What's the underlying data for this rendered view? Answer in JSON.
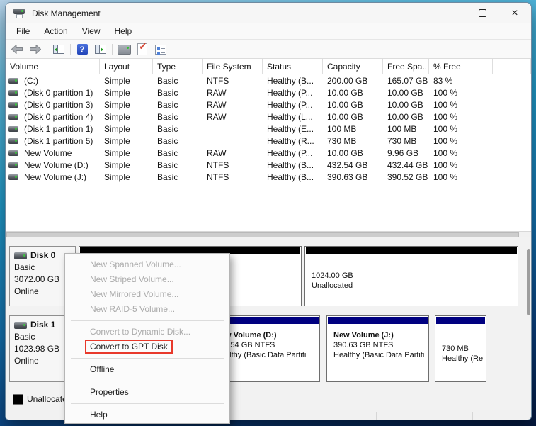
{
  "window": {
    "title": "Disk Management"
  },
  "menu_bar": [
    "File",
    "Action",
    "View",
    "Help"
  ],
  "icons": {
    "help_glyph": "?",
    "close_glyph": "×",
    "check_glyph": "✓"
  },
  "volume_table": {
    "columns": [
      "Volume",
      "Layout",
      "Type",
      "File System",
      "Status",
      "Capacity",
      "Free Spa...",
      "% Free"
    ],
    "rows": [
      {
        "volume": "(C:)",
        "layout": "Simple",
        "type": "Basic",
        "fs": "NTFS",
        "status": "Healthy (B...",
        "capacity": "200.00 GB",
        "free": "165.07 GB",
        "pct": "83 %"
      },
      {
        "volume": "(Disk 0 partition 1)",
        "layout": "Simple",
        "type": "Basic",
        "fs": "RAW",
        "status": "Healthy (P...",
        "capacity": "10.00 GB",
        "free": "10.00 GB",
        "pct": "100 %"
      },
      {
        "volume": "(Disk 0 partition 3)",
        "layout": "Simple",
        "type": "Basic",
        "fs": "RAW",
        "status": "Healthy (P...",
        "capacity": "10.00 GB",
        "free": "10.00 GB",
        "pct": "100 %"
      },
      {
        "volume": "(Disk 0 partition 4)",
        "layout": "Simple",
        "type": "Basic",
        "fs": "RAW",
        "status": "Healthy (L...",
        "capacity": "10.00 GB",
        "free": "10.00 GB",
        "pct": "100 %"
      },
      {
        "volume": "(Disk 1 partition 1)",
        "layout": "Simple",
        "type": "Basic",
        "fs": "",
        "status": "Healthy (E...",
        "capacity": "100 MB",
        "free": "100 MB",
        "pct": "100 %"
      },
      {
        "volume": "(Disk 1 partition 5)",
        "layout": "Simple",
        "type": "Basic",
        "fs": "",
        "status": "Healthy (R...",
        "capacity": "730 MB",
        "free": "730 MB",
        "pct": "100 %"
      },
      {
        "volume": "New Volume",
        "layout": "Simple",
        "type": "Basic",
        "fs": "RAW",
        "status": "Healthy (P...",
        "capacity": "10.00 GB",
        "free": "9.96 GB",
        "pct": "100 %"
      },
      {
        "volume": "New Volume (D:)",
        "layout": "Simple",
        "type": "Basic",
        "fs": "NTFS",
        "status": "Healthy (B...",
        "capacity": "432.54 GB",
        "free": "432.44 GB",
        "pct": "100 %"
      },
      {
        "volume": "New Volume (J:)",
        "layout": "Simple",
        "type": "Basic",
        "fs": "NTFS",
        "status": "Healthy (B...",
        "capacity": "390.63 GB",
        "free": "390.52 GB",
        "pct": "100 %"
      }
    ]
  },
  "disks": [
    {
      "name": "Disk 0",
      "type": "Basic",
      "size": "3072.00 GB",
      "status": "Online",
      "blocks": [
        {
          "kind": "unallocated"
        },
        {
          "kind": "unallocated",
          "size": "1024.00 GB",
          "label": "Unallocated"
        }
      ]
    },
    {
      "name": "Disk 1",
      "type": "Basic",
      "size": "1023.98 GB",
      "status": "Online",
      "blocks": [
        {
          "kind": "primary",
          "title": "New Volume (D:)",
          "size": "432.54 GB NTFS",
          "status": "Healthy (Basic Data Partiti"
        },
        {
          "kind": "primary",
          "title": "New Volume (J:)",
          "size": "390.63 GB NTFS",
          "status": "Healthy (Basic Data Partiti"
        },
        {
          "kind": "primary",
          "size": "730 MB",
          "status": "Healthy (Re"
        }
      ]
    }
  ],
  "context_menu": {
    "items": [
      {
        "label": "New Spanned Volume...",
        "enabled": false
      },
      {
        "label": "New Striped Volume...",
        "enabled": false
      },
      {
        "label": "New Mirrored Volume...",
        "enabled": false
      },
      {
        "label": "New RAID-5 Volume...",
        "enabled": false
      },
      {
        "label": "Convert to Dynamic Disk...",
        "enabled": false
      },
      {
        "label": "Convert to GPT Disk",
        "enabled": true,
        "highlighted": true
      },
      {
        "label": "Offline",
        "enabled": true
      },
      {
        "label": "Properties",
        "enabled": true
      },
      {
        "label": "Help",
        "enabled": true
      }
    ]
  },
  "legend": {
    "label": "Unallocated"
  },
  "colors": {
    "unallocated_strip": "#000000",
    "primary_partition_strip": "#000080",
    "highlight_box": "#e8392b"
  }
}
